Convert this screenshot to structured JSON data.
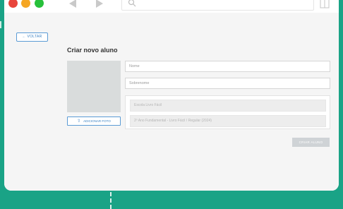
{
  "window": {
    "buttons": [
      "close",
      "minimize",
      "maximize"
    ],
    "icons": [
      "back-arrow-icon",
      "forward-arrow-icon",
      "search-icon",
      "page-icon"
    ]
  },
  "page": {
    "back_label": "← VOLTAR",
    "title": "Criar novo aluno",
    "add_photo_label": "ADICIONAR FOTO",
    "nome_placeholder": "Nome",
    "sobrenome_placeholder": "Sobrenome",
    "escola_value": "Escola Livro Fácil",
    "turma_value": "2º Ano Fundamental - Livro Fácil / Regular (2024)",
    "create_label": "CRIAR ALUNO"
  },
  "colors": {
    "background": "#1aa386",
    "accent": "#3b82c4",
    "disabled_button": "#cfd3d6"
  }
}
